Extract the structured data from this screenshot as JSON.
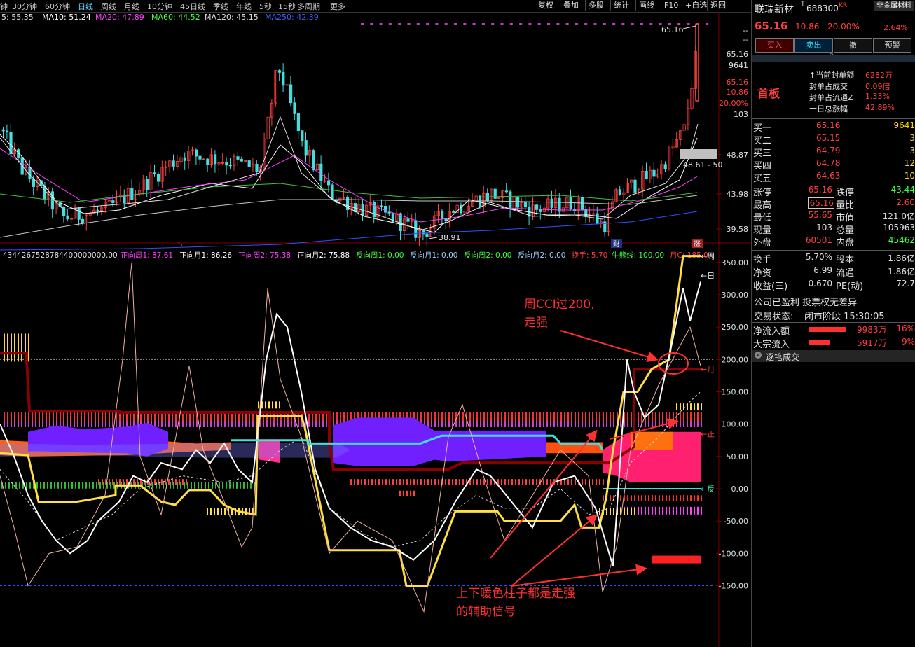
{
  "periods": [
    "钟",
    "30分钟",
    "60分钟",
    "日线",
    "周线",
    "月线",
    "10分钟",
    "45日线",
    "季线",
    "年线",
    "5秒",
    "15秒",
    "多周期",
    "更多"
  ],
  "period_active": 3,
  "toolbar": [
    "复权",
    "叠加",
    "多股",
    "统计",
    "画线",
    "F10",
    "+自选",
    "返回"
  ],
  "ma_legend": [
    {
      "text": "5: 55.35",
      "color": "#e0e0e0"
    },
    {
      "text": "MA10: 51.24",
      "color": "#ffffff"
    },
    {
      "text": "MA20: 47.89",
      "color": "#ff40ff"
    },
    {
      "text": "MA60: 44.52",
      "color": "#40ff40"
    },
    {
      "text": "MA120: 45.15",
      "color": "#e0e0e0"
    },
    {
      "text": "MA250: 42.39",
      "color": "#4060ff"
    }
  ],
  "price_axis": [
    "--",
    "--",
    "65.16",
    "9641",
    "65.16",
    "10.86",
    "20.00%",
    "103",
    "48.87",
    "43.98",
    "39.58"
  ],
  "price_labels": {
    "high": "65.16",
    "low": "38.91",
    "gray": "48.61 - 50",
    "s_mark": "S",
    "cai_mark": "财",
    "zhang_mark": "涨"
  },
  "indicator_legend": [
    {
      "text": "4344267528784400000000.00",
      "color": "#e0e0e0"
    },
    {
      "text": "正向周1: 87.61",
      "color": "#ff40ff"
    },
    {
      "text": "正向月1: 86.26",
      "color": "#ffffff"
    },
    {
      "text": "正向周2: 75.38",
      "color": "#ff40ff"
    },
    {
      "text": "正向月2: 75.88",
      "color": "#ffffff"
    },
    {
      "text": "反向周1: 0.00",
      "color": "#40ff40"
    },
    {
      "text": "反向月1: 0.00",
      "color": "#a0d0ff"
    },
    {
      "text": "反向周2: 0.00",
      "color": "#40ff40"
    },
    {
      "text": "反向月2: 0.00",
      "color": "#a0d0ff"
    },
    {
      "text": "换手: 5.70",
      "color": "#ff4040"
    },
    {
      "text": "牛熊线: 100.00",
      "color": "#40ff40"
    },
    {
      "text": "月C: 185.0",
      "color": "#ff4040"
    }
  ],
  "indicator_axis": [
    "350.00",
    "300.00",
    "250.00",
    "200.00",
    "150.00",
    "100.00",
    "50.00",
    "0.00",
    "-50.00",
    "-100.00",
    "-150.00"
  ],
  "side_tags": [
    "←周",
    "←日",
    "←月",
    "←正",
    "←反"
  ],
  "annotations": {
    "a1_line1": "周CCI过200,",
    "a1_line2": "走强",
    "a2_line1": "上下暖色柱子都是走强",
    "a2_line2": "的辅助信号"
  },
  "stock": {
    "name": "联瑞新材",
    "code": "688300",
    "code_badge": "KR",
    "tag": "非金属材料",
    "tag_change": "2.64%",
    "price": "65.16",
    "change": "10.86",
    "pct": "20.00%",
    "board": "首板"
  },
  "trade_buttons": [
    "买入",
    "卖出",
    "撤",
    "预警"
  ],
  "seal": [
    {
      "label": "↑当前封单额",
      "value": "6282万"
    },
    {
      "label": "封单占成交",
      "value": "0.09倍"
    },
    {
      "label": "封单占流通Z",
      "value": "1.33%"
    },
    {
      "label": "十日总涨幅",
      "value": "42.89%"
    }
  ],
  "order_book": [
    {
      "label": "买一",
      "price": "65.16",
      "vol": "9641"
    },
    {
      "label": "买二",
      "price": "65.15",
      "vol": "3"
    },
    {
      "label": "买三",
      "price": "64.79",
      "vol": "3"
    },
    {
      "label": "买四",
      "price": "64.78",
      "vol": "12"
    },
    {
      "label": "买五",
      "price": "64.63",
      "vol": "10"
    }
  ],
  "stats": [
    {
      "l1": "涨停",
      "v1": "65.16",
      "c1": "#ff4040",
      "l2": "跌停",
      "v2": "43.44",
      "c2": "#40ff40"
    },
    {
      "l1": "最高",
      "v1": "65.16",
      "c1": "#ff4040",
      "l2": "量比",
      "v2": "2.60",
      "c2": "#ff4040"
    },
    {
      "l1": "最低",
      "v1": "55.65",
      "c1": "#ff4040",
      "l2": "市值",
      "v2": "121.0亿",
      "c2": "#e0e0e0"
    },
    {
      "l1": "现量",
      "v1": "103",
      "c1": "#e0e0e0",
      "l2": "总量",
      "v2": "105963",
      "c2": "#e0e0e0"
    },
    {
      "l1": "外盘",
      "v1": "60501",
      "c1": "#ff4040",
      "l2": "内盘",
      "v2": "45462",
      "c2": "#40ff40"
    }
  ],
  "stats2": [
    {
      "l1": "换手",
      "v1": "5.70%",
      "l2": "股本",
      "v2": "1.86亿"
    },
    {
      "l1": "净资",
      "v1": "6.99",
      "l2": "流通",
      "v2": "1.86亿"
    },
    {
      "l1": "收益(三)",
      "v1": "0.670",
      "l2": "PE(动)",
      "v2": "72.7"
    }
  ],
  "company": {
    "line1": "公司已盈利 投票权无差异",
    "status_label": "交易状态:",
    "status": "闭市阶段 15:30:05"
  },
  "flows": [
    {
      "label": "净流入额",
      "value": "9983万",
      "pct": "16%",
      "bar": 0.16
    },
    {
      "label": "大宗流入",
      "value": "5917万",
      "pct": "9%",
      "bar": 0.09
    }
  ],
  "ticks_title": "逐笔成交",
  "colors": {
    "up": "#ff4040",
    "down": "#40e0e0",
    "gold": "#ffd700"
  }
}
